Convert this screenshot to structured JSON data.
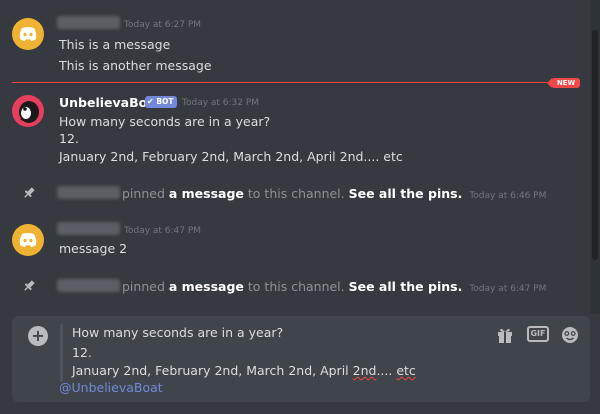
{
  "messages": [
    {
      "timestamp": "Today at 6:27 PM",
      "lines": [
        "This is a message",
        "This is another message"
      ]
    },
    {
      "username": "UnbelievaBoat",
      "bot_tag": "BOT",
      "timestamp": "Today at 6:32 PM",
      "lines": [
        "How many seconds are in a year?",
        "12.",
        "January 2nd, February 2nd, March 2nd, April 2nd.... etc"
      ]
    },
    {
      "timestamp": "Today at 6:47 PM",
      "lines": [
        "message 2"
      ]
    }
  ],
  "new_divider": {
    "label": "NEW"
  },
  "pins": [
    {
      "text_a": "pinned",
      "link_a": "a message",
      "text_b": "to this channel.",
      "link_b": "See all the pins.",
      "timestamp": "Today at 6:46 PM"
    },
    {
      "text_a": "pinned",
      "link_a": "a message",
      "text_b": "to this channel.",
      "link_b": "See all the pins.",
      "timestamp": "Today at 6:47 PM"
    }
  ],
  "composer": {
    "lines": [
      "How many seconds are in a year?",
      "12.",
      "January 2nd, February 2nd, March 2nd, April 2nd.... etc"
    ],
    "mention": "@UnbelievaBoat",
    "gif_label": "GIF"
  },
  "icons": [
    "discord-logo-icon",
    "pin-icon",
    "plus-icon",
    "gift-icon",
    "gif-icon",
    "emoji-icon"
  ],
  "colors": {
    "background": "#36393f",
    "composer": "#40444b",
    "new_divider": "#f04747",
    "bot_tag": "#7289da",
    "avatar_yellow": "#f0b232",
    "avatar_red": "#e83e5d"
  }
}
